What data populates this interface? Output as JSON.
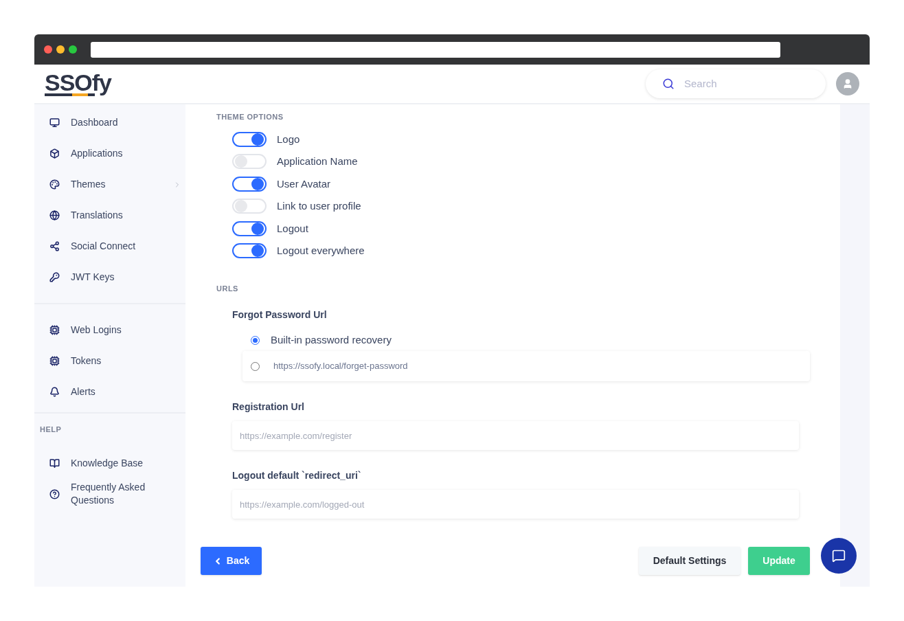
{
  "header": {
    "logo": "SSOfy",
    "search": {
      "placeholder": "Search"
    }
  },
  "sidebar": {
    "groups": [
      {
        "items": [
          {
            "label": "Dashboard",
            "expandable": false
          },
          {
            "label": "Applications",
            "expandable": false
          },
          {
            "label": "Themes",
            "expandable": true
          },
          {
            "label": "Translations",
            "expandable": false
          },
          {
            "label": "Social Connect",
            "expandable": false
          },
          {
            "label": "JWT Keys",
            "expandable": false
          }
        ]
      },
      {
        "items": [
          {
            "label": "Web Logins",
            "expandable": false
          },
          {
            "label": "Tokens",
            "expandable": false
          },
          {
            "label": "Alerts",
            "expandable": false
          }
        ]
      },
      {
        "heading": "HELP",
        "items": [
          {
            "label": "Knowledge Base",
            "expandable": false
          },
          {
            "label": "Frequently Asked Questions",
            "expandable": false
          }
        ]
      }
    ]
  },
  "theme_options": {
    "heading": "THEME OPTIONS",
    "toggles": [
      {
        "label": "Logo",
        "on": true
      },
      {
        "label": "Application Name",
        "on": false
      },
      {
        "label": "User Avatar",
        "on": true
      },
      {
        "label": "Link to user profile",
        "on": false
      },
      {
        "label": "Logout",
        "on": true
      },
      {
        "label": "Logout everywhere",
        "on": true
      }
    ]
  },
  "urls": {
    "heading": "URLS",
    "forgot_password": {
      "label": "Forgot Password Url",
      "options": [
        {
          "kind": "plain",
          "label": "Built-in password recovery",
          "selected": true
        },
        {
          "kind": "field",
          "label": "https://ssofy.local/forget-password",
          "selected": false
        }
      ]
    },
    "fields": [
      {
        "label": "Registration Url",
        "placeholder": "https://example.com/register"
      },
      {
        "label": "Logout default `redirect_uri`",
        "placeholder": "https://example.com/logged-out"
      }
    ]
  },
  "footer": {
    "back": "Back",
    "default_settings": "Default Settings",
    "update": "Update"
  }
}
